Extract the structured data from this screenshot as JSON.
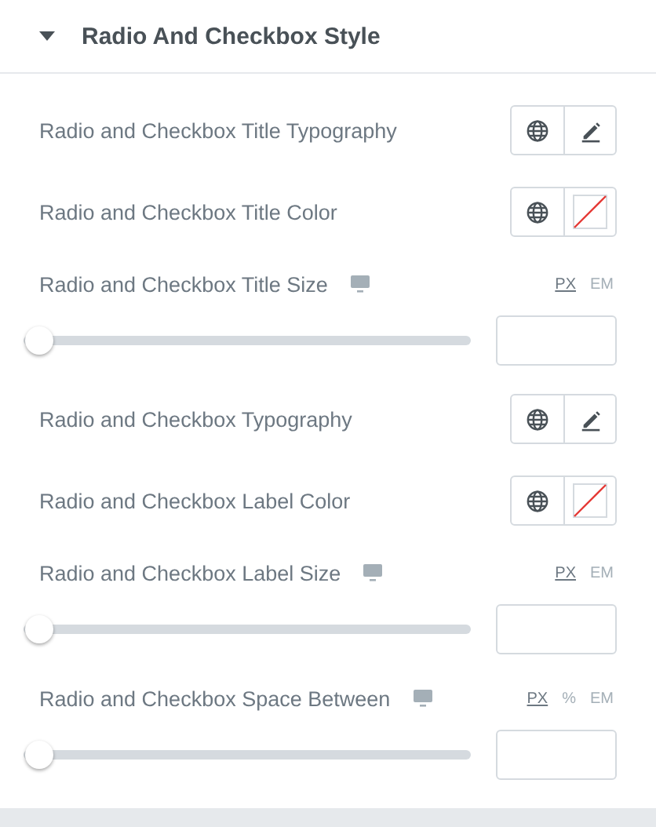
{
  "section": {
    "title": "Radio And Checkbox Style",
    "expanded": true
  },
  "controls": [
    {
      "kind": "popover",
      "label": "Radio and Checkbox Title Typography"
    },
    {
      "kind": "color",
      "label": "Radio and Checkbox Title Color"
    },
    {
      "kind": "slider",
      "label": "Radio and Checkbox Title Size",
      "units": [
        {
          "label": "PX",
          "selected": true
        },
        {
          "label": "EM",
          "selected": false
        }
      ],
      "level": 0
    },
    {
      "kind": "popover",
      "label": "Radio and Checkbox Typography"
    },
    {
      "kind": "color",
      "label": "Radio and Checkbox Label Color"
    },
    {
      "kind": "slider",
      "label": "Radio and Checkbox Label Size",
      "units": [
        {
          "label": "PX",
          "selected": true
        },
        {
          "label": "EM",
          "selected": false
        }
      ],
      "level": 0
    },
    {
      "kind": "slider",
      "label": "Radio and Checkbox Space Between",
      "units": [
        {
          "label": "PX",
          "selected": true
        },
        {
          "label": "%",
          "selected": false
        },
        {
          "label": "EM",
          "selected": false
        }
      ],
      "level": 0
    }
  ]
}
